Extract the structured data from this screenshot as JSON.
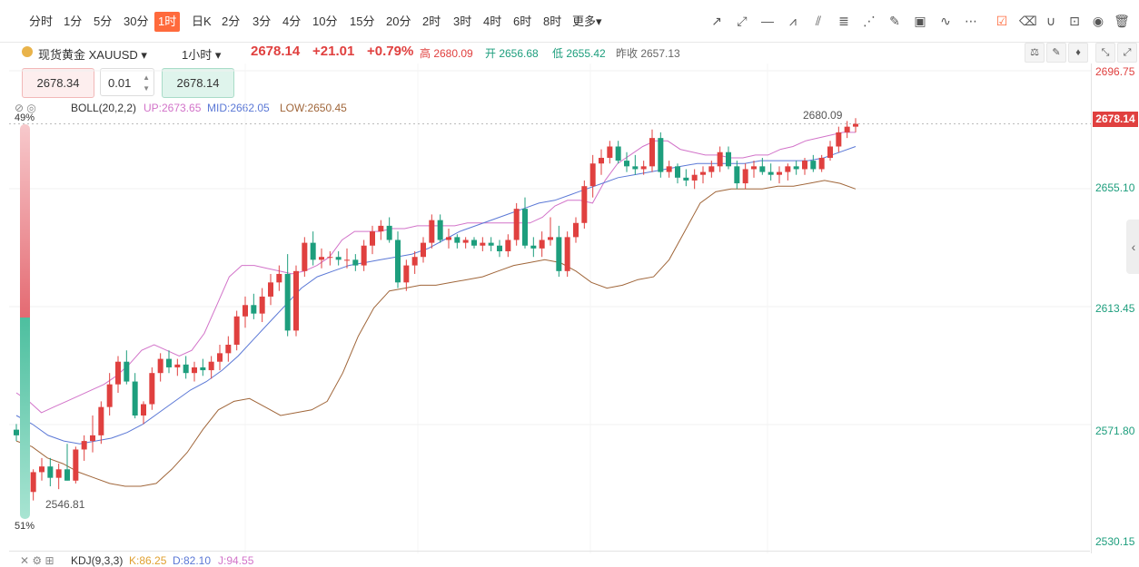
{
  "timeframes": [
    "分时",
    "1分",
    "5分",
    "30分",
    "1时",
    "日K",
    "2分",
    "3分",
    "4分",
    "10分",
    "15分",
    "20分",
    "2时",
    "3时",
    "4时",
    "6时",
    "8时",
    "更多▾"
  ],
  "active_timeframe": "1时",
  "symbol": {
    "name": "现货黄金 XAUUSD ▾",
    "period": "1小时 ▾",
    "price": "2678.14",
    "change": "+21.01",
    "change_pct": "+0.79%",
    "high": "高 2680.09",
    "open": "开 2656.68",
    "low": "低 2655.42",
    "prev": "昨收 2657.13"
  },
  "order": {
    "sell": "2678.34",
    "lot": "0.01",
    "buy": "2678.14"
  },
  "boll": {
    "label": "BOLL(20,2,2)",
    "up": "UP:2673.65",
    "mid": "MID:2662.05",
    "low": "LOW:2650.45"
  },
  "kdj": {
    "label": "KDJ(9,3,3)",
    "k": "K:86.25",
    "d": "D:82.10",
    "j": "J:94.55"
  },
  "y_ticks": [
    "2696.75",
    "2655.10",
    "2613.45",
    "2571.80",
    "2530.15"
  ],
  "last_price_tag": "2678.14",
  "high_label": "2680.09",
  "low_label": "2546.81",
  "sentiment": {
    "top": "49%",
    "bottom": "51%"
  },
  "colors": {
    "up": "#e0403f",
    "down": "#1d9e7d",
    "boll_up": "#d273c9",
    "boll_mid": "#5b78d6",
    "boll_low": "#a0663a",
    "accent": "#ff6a3c"
  },
  "chart_data": {
    "type": "candlestick",
    "ylim": [
      2530.15,
      2696.75
    ],
    "candles": [
      [
        2570,
        2572,
        2566,
        2568
      ],
      [
        2568,
        2585,
        2548,
        2548
      ],
      [
        2548,
        2556,
        2545,
        2555
      ],
      [
        2555,
        2560,
        2552,
        2557
      ],
      [
        2557,
        2560,
        2550,
        2553
      ],
      [
        2553,
        2558,
        2549,
        2556
      ],
      [
        2556,
        2565,
        2552,
        2552
      ],
      [
        2552,
        2564,
        2551,
        2563
      ],
      [
        2563,
        2568,
        2559,
        2566
      ],
      [
        2566,
        2575,
        2562,
        2568
      ],
      [
        2568,
        2580,
        2565,
        2578
      ],
      [
        2578,
        2590,
        2575,
        2586
      ],
      [
        2586,
        2596,
        2583,
        2594
      ],
      [
        2594,
        2598,
        2586,
        2587
      ],
      [
        2587,
        2590,
        2574,
        2575
      ],
      [
        2575,
        2580,
        2572,
        2579
      ],
      [
        2579,
        2592,
        2577,
        2590
      ],
      [
        2590,
        2597,
        2587,
        2595
      ],
      [
        2595,
        2598,
        2590,
        2592
      ],
      [
        2592,
        2595,
        2589,
        2593
      ],
      [
        2593,
        2596,
        2588,
        2590
      ],
      [
        2590,
        2594,
        2587,
        2592
      ],
      [
        2592,
        2595,
        2589,
        2591
      ],
      [
        2591,
        2596,
        2588,
        2594
      ],
      [
        2594,
        2600,
        2591,
        2597
      ],
      [
        2597,
        2603,
        2594,
        2600
      ],
      [
        2600,
        2612,
        2598,
        2610
      ],
      [
        2610,
        2617,
        2606,
        2614
      ],
      [
        2614,
        2618,
        2609,
        2611
      ],
      [
        2611,
        2620,
        2608,
        2617
      ],
      [
        2617,
        2625,
        2614,
        2622
      ],
      [
        2622,
        2628,
        2619,
        2625
      ],
      [
        2625,
        2632,
        2603,
        2605
      ],
      [
        2605,
        2628,
        2603,
        2626
      ],
      [
        2626,
        2638,
        2624,
        2636
      ],
      [
        2636,
        2640,
        2628,
        2630
      ],
      [
        2630,
        2634,
        2627,
        2631
      ],
      [
        2631,
        2633,
        2628,
        2631
      ],
      [
        2631,
        2633,
        2628,
        2630
      ],
      [
        2630,
        2634,
        2627,
        2630
      ],
      [
        2630,
        2632,
        2626,
        2628
      ],
      [
        2628,
        2637,
        2626,
        2635
      ],
      [
        2635,
        2642,
        2632,
        2640
      ],
      [
        2640,
        2644,
        2637,
        2642
      ],
      [
        2642,
        2645,
        2636,
        2637
      ],
      [
        2637,
        2640,
        2620,
        2622
      ],
      [
        2622,
        2630,
        2619,
        2628
      ],
      [
        2628,
        2633,
        2625,
        2631
      ],
      [
        2631,
        2638,
        2629,
        2636
      ],
      [
        2636,
        2646,
        2634,
        2644
      ],
      [
        2644,
        2646,
        2636,
        2637
      ],
      [
        2637,
        2641,
        2634,
        2638
      ],
      [
        2638,
        2639,
        2634,
        2636
      ],
      [
        2636,
        2638,
        2634,
        2637
      ],
      [
        2637,
        2638,
        2634,
        2635
      ],
      [
        2635,
        2638,
        2633,
        2636
      ],
      [
        2636,
        2638,
        2633,
        2635
      ],
      [
        2635,
        2637,
        2631,
        2633
      ],
      [
        2633,
        2639,
        2631,
        2637
      ],
      [
        2637,
        2650,
        2635,
        2648
      ],
      [
        2648,
        2652,
        2634,
        2635
      ],
      [
        2635,
        2638,
        2631,
        2634
      ],
      [
        2634,
        2640,
        2631,
        2637
      ],
      [
        2637,
        2645,
        2635,
        2638
      ],
      [
        2638,
        2642,
        2624,
        2626
      ],
      [
        2626,
        2640,
        2624,
        2638
      ],
      [
        2638,
        2645,
        2636,
        2643
      ],
      [
        2643,
        2658,
        2641,
        2656
      ],
      [
        2656,
        2667,
        2652,
        2664
      ],
      [
        2664,
        2669,
        2660,
        2666
      ],
      [
        2666,
        2672,
        2664,
        2670
      ],
      [
        2670,
        2672,
        2664,
        2665
      ],
      [
        2665,
        2668,
        2661,
        2663
      ],
      [
        2663,
        2667,
        2660,
        2662
      ],
      [
        2662,
        2665,
        2660,
        2663
      ],
      [
        2663,
        2676,
        2661,
        2673
      ],
      [
        2673,
        2675,
        2659,
        2661
      ],
      [
        2661,
        2665,
        2659,
        2663
      ],
      [
        2663,
        2664,
        2657,
        2659
      ],
      [
        2659,
        2662,
        2656,
        2658
      ],
      [
        2658,
        2662,
        2655,
        2660
      ],
      [
        2660,
        2663,
        2657,
        2661
      ],
      [
        2661,
        2665,
        2659,
        2663
      ],
      [
        2663,
        2670,
        2661,
        2668
      ],
      [
        2668,
        2670,
        2662,
        2663
      ],
      [
        2663,
        2665,
        2655,
        2657
      ],
      [
        2657,
        2664,
        2655,
        2662
      ],
      [
        2662,
        2665,
        2659,
        2663
      ],
      [
        2663,
        2666,
        2660,
        2661
      ],
      [
        2661,
        2664,
        2658,
        2660
      ],
      [
        2660,
        2663,
        2657,
        2661
      ],
      [
        2661,
        2664,
        2658,
        2663
      ],
      [
        2663,
        2665,
        2660,
        2662
      ],
      [
        2662,
        2666,
        2660,
        2665
      ],
      [
        2665,
        2667,
        2661,
        2662
      ],
      [
        2662,
        2667,
        2661,
        2666
      ],
      [
        2666,
        2672,
        2665,
        2670
      ],
      [
        2670,
        2677,
        2668,
        2675
      ],
      [
        2675,
        2679,
        2673,
        2677
      ],
      [
        2677,
        2680,
        2675,
        2678
      ]
    ],
    "boll_up": [
      2583,
      2580,
      2576,
      2578,
      2580,
      2582,
      2584,
      2586,
      2589,
      2593,
      2598,
      2600,
      2598,
      2596,
      2598,
      2604,
      2614,
      2624,
      2628,
      2628,
      2627,
      2626,
      2625,
      2626,
      2628,
      2631,
      2637,
      2640,
      2640,
      2640,
      2641,
      2641,
      2642,
      2642,
      2642,
      2642,
      2643,
      2643,
      2643,
      2643,
      2643,
      2643,
      2645,
      2649,
      2651,
      2651,
      2650,
      2658,
      2664,
      2667,
      2670,
      2672,
      2672,
      2669,
      2668,
      2667,
      2667,
      2666,
      2666,
      2667,
      2667,
      2669,
      2670,
      2672,
      2673,
      2674,
      2675,
      2675
    ],
    "boll_mid": [
      2575,
      2572,
      2568,
      2566,
      2565,
      2566,
      2567,
      2569,
      2572,
      2576,
      2580,
      2584,
      2587,
      2591,
      2596,
      2602,
      2608,
      2614,
      2620,
      2624,
      2626,
      2628,
      2629,
      2630,
      2631,
      2632,
      2634,
      2637,
      2640,
      2642,
      2644,
      2646,
      2648,
      2650,
      2651,
      2653,
      2655,
      2657,
      2659,
      2660,
      2661,
      2662,
      2663,
      2664,
      2664,
      2664,
      2664,
      2665,
      2665,
      2665,
      2665,
      2666,
      2668,
      2670
    ],
    "boll_low": [
      2566,
      2564,
      2560,
      2558,
      2555,
      2553,
      2551,
      2550,
      2550,
      2551,
      2556,
      2562,
      2570,
      2577,
      2580,
      2581,
      2578,
      2575,
      2576,
      2577,
      2580,
      2590,
      2603,
      2613,
      2619,
      2620,
      2621,
      2621,
      2622,
      2623,
      2624,
      2626,
      2628,
      2629,
      2630,
      2629,
      2626,
      2622,
      2620,
      2621,
      2623,
      2624,
      2630,
      2640,
      2650,
      2654,
      2655,
      2655,
      2655,
      2656,
      2656,
      2657,
      2658,
      2657,
      2655
    ]
  }
}
